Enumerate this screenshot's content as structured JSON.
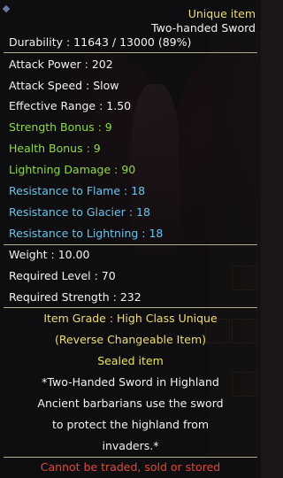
{
  "item": {
    "rarity": "Unique item",
    "type": "Two-handed Sword",
    "durability": "Durability : 11643 / 13000 (89%)",
    "stats": [
      {
        "text": "Attack Power : 202",
        "color": "white"
      },
      {
        "text": "Attack Speed : Slow",
        "color": "white"
      },
      {
        "text": "Effective Range : 1.50",
        "color": "white"
      },
      {
        "text": "Strength Bonus : 9",
        "color": "green"
      },
      {
        "text": "Health Bonus : 9",
        "color": "green"
      },
      {
        "text": "Lightning Damage : 90",
        "color": "green"
      },
      {
        "text": "Resistance to Flame : 18",
        "color": "blue"
      },
      {
        "text": "Resistance to Glacier : 18",
        "color": "blue"
      },
      {
        "text": "Resistance to Lightning : 18",
        "color": "blue"
      }
    ],
    "requirements": [
      "Weight : 10.00",
      "Required Level : 70",
      "Required Strength : 232"
    ],
    "grade": "Item Grade : High Class Unique",
    "grade_note": "(Reverse Changeable Item)",
    "sealed": "Sealed item",
    "description": [
      "*Two-Handed Sword in Highland",
      "Ancient barbarians use the sword",
      "to protect the highland from",
      "invaders.*"
    ],
    "restriction": "Cannot be traded, sold or stored"
  },
  "colors": {
    "white": "#f2f2f2",
    "green": "#8ddb45",
    "blue": "#6cc3e8",
    "gold": "#f0dc78",
    "yellow": "#e8e85a",
    "red": "#e04a3a"
  }
}
